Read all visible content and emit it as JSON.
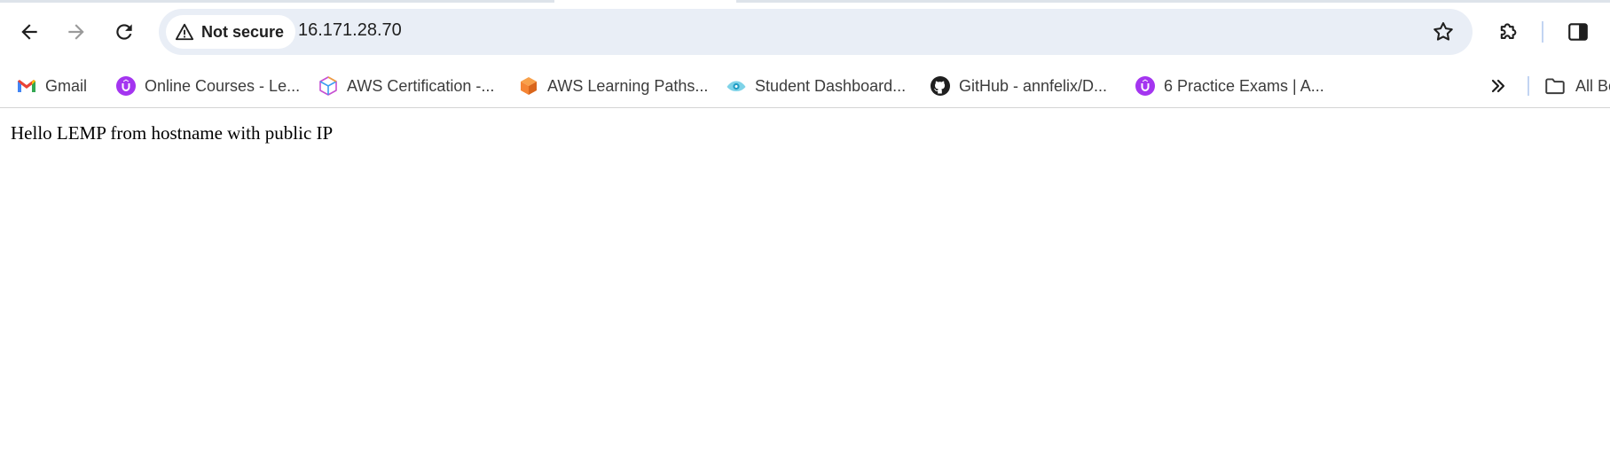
{
  "toolbar": {
    "security_label": "Not secure",
    "url": "16.171.28.70",
    "icons": {
      "back": "arrow-left-icon",
      "forward": "arrow-right-icon",
      "reload": "reload-icon",
      "security": "warning-triangle-icon",
      "bookmark_star": "star-icon",
      "extensions": "puzzle-icon",
      "side_panel": "side-panel-icon"
    }
  },
  "bookmarks": {
    "items": [
      {
        "label": "Gmail",
        "icon": "gmail-icon"
      },
      {
        "label": "Online Courses - Le...",
        "icon": "udemy-icon"
      },
      {
        "label": "AWS Certification -...",
        "icon": "aws-cube-icon"
      },
      {
        "label": "AWS Learning Paths...",
        "icon": "orange-cube-icon"
      },
      {
        "label": "Student Dashboard...",
        "icon": "eye-icon"
      },
      {
        "label": "GitHub - annfelix/D...",
        "icon": "github-icon"
      },
      {
        "label": "6 Practice Exams | A...",
        "icon": "udemy-icon"
      }
    ],
    "overflow_icon": "double-chevron-right-icon",
    "all_bookmarks_label": "All Bookmarks",
    "all_bookmarks_icon": "folder-icon"
  },
  "page": {
    "text": "Hello LEMP from hostname with public IP"
  },
  "colors": {
    "omnibox_bg": "#e9eef6",
    "udemy_purple": "#a435f0",
    "aws_orange": "#f58534",
    "divider_blue": "#c2d4f2"
  }
}
